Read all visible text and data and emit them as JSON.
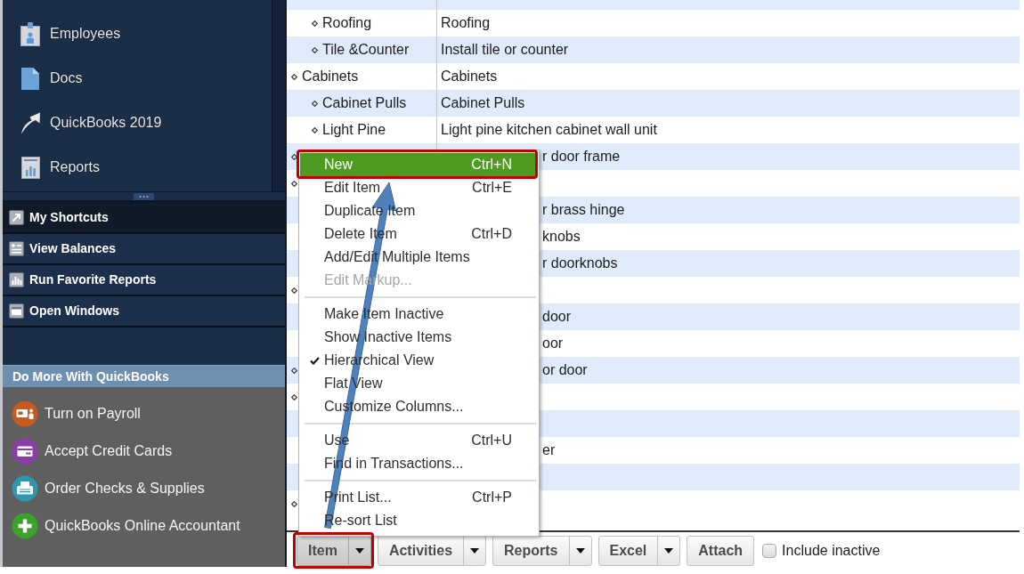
{
  "sidebar": {
    "nav_items": [
      {
        "label": "Employees"
      },
      {
        "label": "Docs"
      },
      {
        "label": "QuickBooks 2019"
      },
      {
        "label": "Reports"
      }
    ],
    "shortcut_tabs": [
      {
        "label": "My Shortcuts",
        "selected": true
      },
      {
        "label": "View Balances",
        "selected": false
      },
      {
        "label": "Run Favorite Reports",
        "selected": false
      },
      {
        "label": "Open Windows",
        "selected": false
      }
    ],
    "promo": {
      "title": "Do More With QuickBooks",
      "items": [
        {
          "label": "Turn on Payroll"
        },
        {
          "label": "Accept Credit Cards"
        },
        {
          "label": "Order Checks & Supplies"
        },
        {
          "label": "QuickBooks Online Accountant"
        }
      ]
    }
  },
  "item_list": {
    "continued_children": [
      {
        "kind": "row",
        "name": "Roofing",
        "description": "Roofing"
      },
      {
        "kind": "row",
        "name": "Tile &Counter",
        "description": "Install tile or counter"
      }
    ],
    "rows": [
      {
        "kind": "row",
        "name": "Cabinets",
        "description": "Cabinets",
        "children": [
          {
            "kind": "row",
            "name": "Cabinet Pulls",
            "description": "Cabinet Pulls"
          },
          {
            "kind": "row",
            "name": "Light Pine",
            "description": "Light pine kitchen cabinet wall unit"
          }
        ]
      },
      {
        "kind": "under_menu",
        "description": "r door frame"
      },
      {
        "kind": "under_menu",
        "children": [
          {
            "kind": "under_menu",
            "description": "r brass hinge"
          },
          {
            "kind": "under_menu",
            "description": "knobs"
          },
          {
            "kind": "under_menu",
            "description": "r doorknobs"
          }
        ]
      },
      {
        "kind": "under_menu",
        "children": [
          {
            "kind": "under_menu",
            "description": "door"
          },
          {
            "kind": "under_menu",
            "description": "oor"
          }
        ]
      },
      {
        "kind": "under_menu",
        "description": "or door"
      },
      {
        "kind": "under_menu",
        "children": [
          {
            "kind": "under_menu"
          },
          {
            "kind": "under_menu",
            "description": "er"
          },
          {
            "kind": "under_menu"
          }
        ]
      },
      {
        "kind": "under_menu"
      }
    ]
  },
  "item_menu": {
    "entries": [
      {
        "kind": "item",
        "label": "New",
        "shortcut": "Ctrl+N",
        "selected": true,
        "disabled": false,
        "checked": false,
        "callout": true
      },
      {
        "kind": "item",
        "label": "Edit Item",
        "shortcut": "Ctrl+E",
        "selected": false,
        "disabled": false,
        "checked": false,
        "callout": false
      },
      {
        "kind": "item",
        "label": "Duplicate Item",
        "selected": false,
        "disabled": false,
        "checked": false,
        "callout": false
      },
      {
        "kind": "item",
        "label": "Delete Item",
        "shortcut": "Ctrl+D",
        "selected": false,
        "disabled": false,
        "checked": false,
        "callout": false
      },
      {
        "kind": "item",
        "label": "Add/Edit Multiple Items",
        "selected": false,
        "disabled": false,
        "checked": false,
        "callout": false
      },
      {
        "kind": "item",
        "label": "Edit Markup...",
        "selected": false,
        "disabled": true,
        "checked": false,
        "callout": false
      },
      {
        "kind": "separator"
      },
      {
        "kind": "item",
        "label": "Make Item Inactive",
        "selected": false,
        "disabled": false,
        "checked": false,
        "callout": false
      },
      {
        "kind": "item",
        "label": "Show Inactive Items",
        "selected": false,
        "disabled": false,
        "checked": false,
        "callout": false
      },
      {
        "kind": "item",
        "label": "Hierarchical View",
        "selected": false,
        "disabled": false,
        "checked": true,
        "callout": false
      },
      {
        "kind": "item",
        "label": "Flat View",
        "selected": false,
        "disabled": false,
        "checked": false,
        "callout": false
      },
      {
        "kind": "item",
        "label": "Customize Columns...",
        "selected": false,
        "disabled": false,
        "checked": false,
        "callout": false
      },
      {
        "kind": "separator"
      },
      {
        "kind": "item",
        "label": "Use",
        "shortcut": "Ctrl+U",
        "selected": false,
        "disabled": false,
        "checked": false,
        "callout": false
      },
      {
        "kind": "item",
        "label": "Find in Transactions...",
        "selected": false,
        "disabled": false,
        "checked": false,
        "callout": false
      },
      {
        "kind": "separator"
      },
      {
        "kind": "item",
        "label": "Print List...",
        "shortcut": "Ctrl+P",
        "selected": false,
        "disabled": false,
        "checked": false,
        "callout": false
      },
      {
        "kind": "item",
        "label": "Re-sort List",
        "selected": false,
        "disabled": false,
        "checked": false,
        "callout": false
      }
    ]
  },
  "toolbar": {
    "buttons": [
      {
        "label": "Item",
        "dropdown": true,
        "pressed": true,
        "callout": true
      },
      {
        "label": "Activities",
        "dropdown": true,
        "pressed": false,
        "callout": false
      },
      {
        "label": "Reports",
        "dropdown": true,
        "pressed": false,
        "callout": false
      },
      {
        "label": "Excel",
        "dropdown": true,
        "pressed": false,
        "callout": false
      },
      {
        "label": "Attach",
        "dropdown": false,
        "pressed": false,
        "callout": false
      }
    ],
    "include_inactive": {
      "label": "Include inactive",
      "checked": false
    }
  }
}
